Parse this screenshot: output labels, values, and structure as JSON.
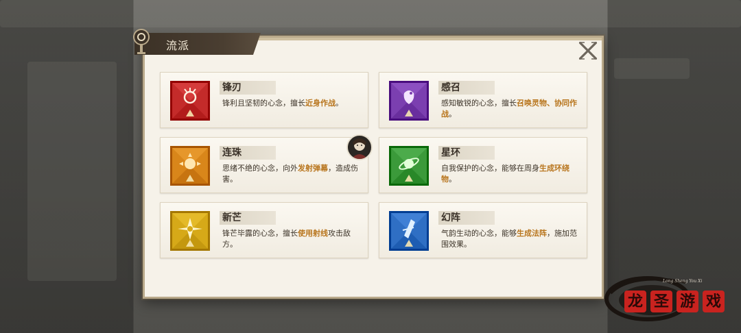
{
  "dialog": {
    "title": "流派",
    "close_label": "X"
  },
  "schools": [
    {
      "name": "锋刃",
      "desc_parts": [
        "锋利且坚韧的心念，擅长",
        "近身作战",
        "。"
      ],
      "emblem": "blade-emblem-icon",
      "color": "#c42b2a"
    },
    {
      "name": "感召",
      "desc_parts": [
        "感知敏锐的心念，擅长",
        "召唤灵物、协同作战",
        "。"
      ],
      "emblem": "summon-emblem-icon",
      "color": "#7b3fb0"
    },
    {
      "name": "连珠",
      "desc_parts": [
        "思绪不绝的心念，向外",
        "发射弹幕",
        "，造成伤害。"
      ],
      "emblem": "barrage-emblem-icon",
      "color": "#d9861a"
    },
    {
      "name": "星环",
      "desc_parts": [
        "自我保护的心念，能够在周身",
        "生成环绕物",
        "。"
      ],
      "emblem": "orbit-emblem-icon",
      "color": "#3b9a3a"
    },
    {
      "name": "新芒",
      "desc_parts": [
        "锋芒毕露的心念，擅长",
        "使用射线",
        "攻击敌方。"
      ],
      "emblem": "ray-emblem-icon",
      "color": "#d6a918"
    },
    {
      "name": "幻阵",
      "desc_parts": [
        "气韵生动的心念，能够",
        "生成法阵",
        "，施加范围效果。"
      ],
      "emblem": "array-emblem-icon",
      "color": "#2f6fc4"
    }
  ],
  "watermark": {
    "caption": "Long Sheng You Xi",
    "chars": [
      "龙",
      "圣",
      "游",
      "戏"
    ]
  }
}
